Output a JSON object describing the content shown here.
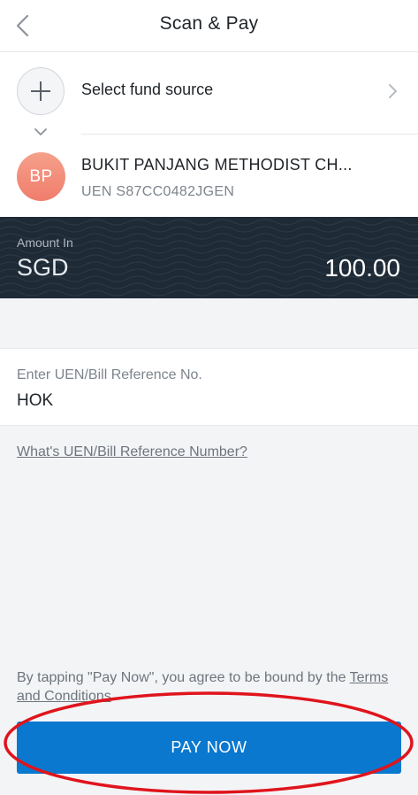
{
  "header": {
    "title": "Scan & Pay",
    "back_icon": "chevron-left-icon"
  },
  "fund_source": {
    "label": "Select fund source",
    "add_icon": "plus-icon",
    "arrow_icon": "chevron-right-icon",
    "expand_icon": "chevron-down-icon"
  },
  "payee": {
    "initials": "BP",
    "name": "BUKIT PANJANG METHODIST CH...",
    "uen": "UEN S87CC0482JGEN"
  },
  "amount": {
    "label": "Amount In",
    "currency": "SGD",
    "value": "100.00"
  },
  "reference": {
    "label": "Enter UEN/Bill Reference No.",
    "value": "HOK"
  },
  "help_link": "What's UEN/Bill Reference Number?",
  "terms": {
    "prefix": "By tapping \"Pay Now\", you agree to be bound by the ",
    "link": "Terms and Conditions",
    "suffix": "."
  },
  "pay_button": {
    "label": "PAY NOW"
  },
  "colors": {
    "primary": "#0a78cf",
    "panel": "#1e2a36",
    "avatar": "#f07d6d",
    "annotation": "#e0141c"
  }
}
